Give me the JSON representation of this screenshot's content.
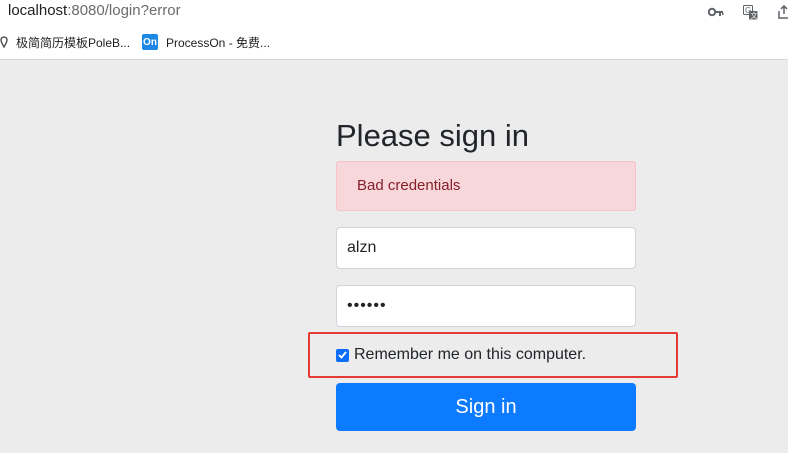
{
  "browser": {
    "url_host": "localhost",
    "url_rest": ":8080/login?error",
    "icons": [
      "key-icon",
      "translate-icon",
      "share-icon"
    ]
  },
  "bookmarks": [
    {
      "icon": "map-pin-icon",
      "label": "极简简历模板PoleB..."
    },
    {
      "icon": "processon-icon",
      "icon_text": "On",
      "label": "ProcessOn - 免费..."
    }
  ],
  "login": {
    "heading": "Please sign in",
    "alert": "Bad credentials",
    "username_value": "alzn",
    "password_value": "••••••",
    "remember_label": "Remember me on this computer.",
    "remember_checked": true,
    "submit_label": "Sign in"
  },
  "colors": {
    "alert_bg": "#f8d7da",
    "alert_text": "#842029",
    "primary": "#0d7bff",
    "highlight": "#e53935"
  }
}
